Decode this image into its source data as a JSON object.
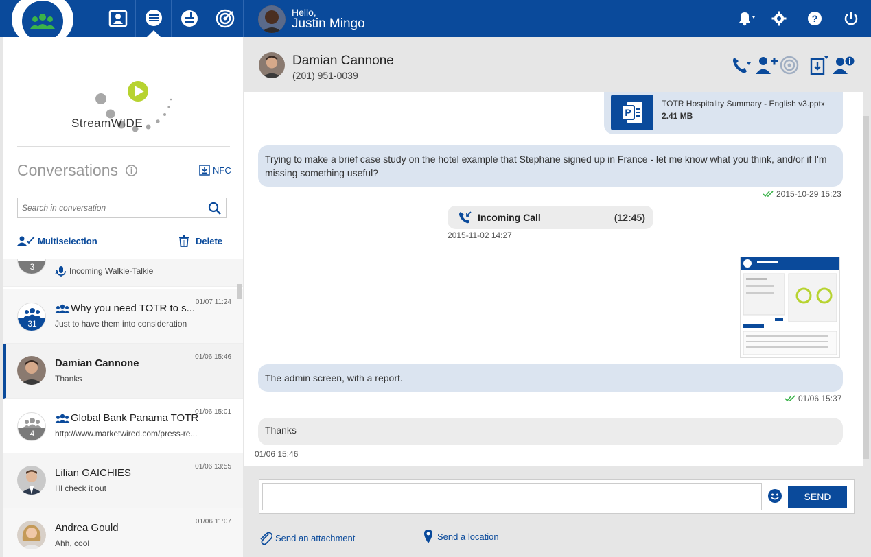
{
  "topbar": {
    "hello": "Hello,",
    "username": "Justin Mingo",
    "nav_icons": [
      "contacts-icon",
      "conversations-icon",
      "broadcast-icon",
      "radar-icon"
    ],
    "right_icons": [
      "bell-icon",
      "gear-icon",
      "help-icon",
      "power-icon"
    ]
  },
  "sidebar": {
    "brand": "StreamWIDE",
    "title": "Conversations",
    "nfc_label": "NFC",
    "search_placeholder": "Search in conversation",
    "multiselection_label": "Multiselection",
    "delete_label": "Delete",
    "conversations": [
      {
        "badge": "3",
        "name": "",
        "preview": "Incoming Walkie-Talkie",
        "time": ""
      },
      {
        "badge": "31",
        "name": "Why you need TOTR to s...",
        "preview": "Just to have them into consideration",
        "time": "01/07 11:24"
      },
      {
        "name": "Damian Cannone",
        "preview": "Thanks",
        "time": "01/06 15:46"
      },
      {
        "badge": "4",
        "name": "Global Bank Panama TOTR",
        "preview": "http://www.marketwired.com/press-re...",
        "time": "01/06 15:01"
      },
      {
        "name": "Lilian GAICHIES",
        "preview": "I'll check it out",
        "time": "01/06 13:55"
      },
      {
        "name": "Andrea Gould",
        "preview": "Ahh, cool",
        "time": "01/06 11:07"
      }
    ]
  },
  "chat": {
    "contact_name": "Damian Cannone",
    "contact_phone": "(201) 951-0039",
    "file_name": "TOTR Hospitality Summary - English v3.pptx",
    "file_size": "2.41 MB",
    "msg1": "Trying to make a brief case study on the hotel example that Stephane signed up in France - let me know what you think, and/or if I'm missing something useful?",
    "msg1_time": "2015-10-29 15:23",
    "call_label": "Incoming Call",
    "call_duration": "(12:45)",
    "call_time": "2015-11-02 14:27",
    "msg2": "The admin screen, with a report.",
    "msg2_time": "01/06 15:37",
    "msg3": "Thanks",
    "msg3_time": "01/06 15:46"
  },
  "composer": {
    "send_label": "SEND",
    "attach_label": "Send an attachment",
    "location_label": "Send a location"
  },
  "colors": {
    "brand_blue": "#0a4a9b",
    "bubble_out": "#dbe4f0",
    "bubble_in": "#ececec",
    "check_green": "#3bb34a"
  }
}
